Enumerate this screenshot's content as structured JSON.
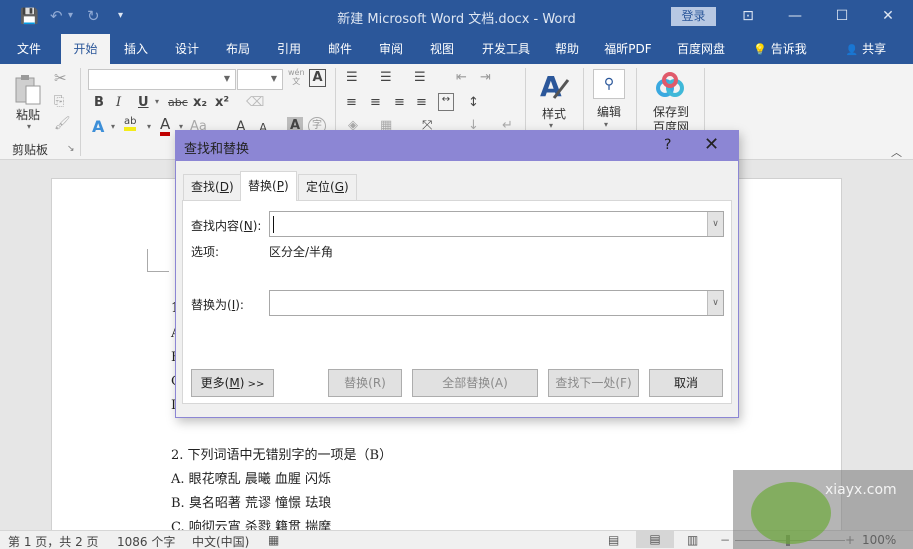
{
  "window": {
    "title": "新建 Microsoft Word 文档.docx  -  Word",
    "login_label": "登录",
    "controls": {
      "ribbon_display": "⊡",
      "minimize": "—",
      "maximize": "☐",
      "close": "✕"
    },
    "qat": {
      "save": "💾",
      "undo": "↶",
      "undo_dd": "▾",
      "redo": "↻",
      "customize": "▾"
    }
  },
  "ribbon_tabs": [
    {
      "label": "文件"
    },
    {
      "label": "开始"
    },
    {
      "label": "插入"
    },
    {
      "label": "设计"
    },
    {
      "label": "布局"
    },
    {
      "label": "引用"
    },
    {
      "label": "邮件"
    },
    {
      "label": "审阅"
    },
    {
      "label": "视图"
    },
    {
      "label": "开发工具"
    },
    {
      "label": "帮助"
    },
    {
      "label": "福昕PDF"
    },
    {
      "label": "百度网盘"
    }
  ],
  "tell_me": {
    "icon": "💡",
    "label": "告诉我"
  },
  "share": {
    "icon": "👤",
    "label": "共享"
  },
  "ribbon": {
    "clipboard": {
      "paste_label": "粘贴",
      "group_label": "剪贴板",
      "launcher": "↘"
    },
    "font": {
      "font_name": "",
      "font_size": "",
      "phonetic_top": "wén",
      "phonetic_bottom": "文",
      "char_border": "A",
      "bold": "B",
      "italic": "I",
      "underline": "U",
      "strike": "abc",
      "subscript": "x₂",
      "superscript": "x²",
      "text_effects": "A",
      "highlight": "ab",
      "font_color": "A",
      "change_case": "Aa",
      "grow": "A",
      "shrink": "A",
      "shading": "A",
      "enclose": "字"
    },
    "styles": {
      "label": "样式"
    },
    "editing": {
      "label": "编辑"
    },
    "baidu": {
      "label_line1": "保存到",
      "label_line2": "百度网盘"
    },
    "collapse": "︿"
  },
  "document": {
    "lines": [
      {
        "text": "2. 下列词语中无错别字的一项是（B）"
      },
      {
        "text": "A. 眼花嘹乱 晨曦 血腥 闪烁"
      },
      {
        "text": "B. 臭名昭著 荒谬 憧憬 珐琅"
      },
      {
        "text": "C. 响彻云宵 杀戮 籍贯 揣摩"
      }
    ],
    "partial_left_letters": [
      "1",
      "A",
      "B",
      "C",
      "D"
    ]
  },
  "dialog": {
    "title": "查找和替换",
    "help": "?",
    "close": "✕",
    "tabs": [
      {
        "label": "查找",
        "key": "D"
      },
      {
        "label": "替换",
        "key": "P",
        "active": true
      },
      {
        "label": "定位",
        "key": "G"
      }
    ],
    "find": {
      "label": "查找内容",
      "key": "N",
      "value": ""
    },
    "options": {
      "label": "选项:",
      "value": "区分全/半角"
    },
    "replace": {
      "label": "替换为",
      "key": "I",
      "value": ""
    },
    "buttons": {
      "more": {
        "label": "更多",
        "key": "M",
        "suffix": " >>"
      },
      "replace": {
        "label": "替换(R)",
        "enabled": false
      },
      "replace_all": {
        "label": "全部替换(A)",
        "enabled": false
      },
      "find_next": {
        "label": "查找下一处(F)",
        "enabled": false
      },
      "cancel": {
        "label": "取消",
        "enabled": true
      }
    }
  },
  "status": {
    "page": "第 1 页，共 2 页",
    "words": "1086 个字",
    "language": "中文(中国)",
    "zoom_minus": "−",
    "zoom_plus": "+",
    "zoom_level": "100%",
    "zoom_percent": 100
  },
  "watermark": {
    "text": "xiayx.com"
  }
}
